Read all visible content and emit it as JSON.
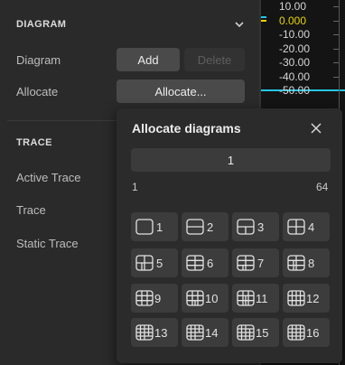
{
  "diagram_section": {
    "title": "DIAGRAM",
    "diagram_label": "Diagram",
    "add_label": "Add",
    "delete_label": "Delete",
    "allocate_label": "Allocate",
    "allocate_button": "Allocate..."
  },
  "trace_section": {
    "title": "TRACE",
    "active_trace_label": "Active Trace",
    "trace_label": "Trace",
    "static_trace_label": "Static Trace"
  },
  "plot": {
    "ticks": [
      "10.00",
      "0.000",
      "-10.00",
      "-20.00",
      "-30.00",
      "-40.00",
      "-50.00"
    ],
    "colors": {
      "yellow": "#e6d600",
      "cyan": "#22c6e6"
    }
  },
  "popup": {
    "title": "Allocate diagrams",
    "value": "1",
    "min": "1",
    "max": "64",
    "options": [
      "1",
      "2",
      "3",
      "4",
      "5",
      "6",
      "7",
      "8",
      "9",
      "10",
      "11",
      "12",
      "13",
      "14",
      "15",
      "16"
    ]
  }
}
